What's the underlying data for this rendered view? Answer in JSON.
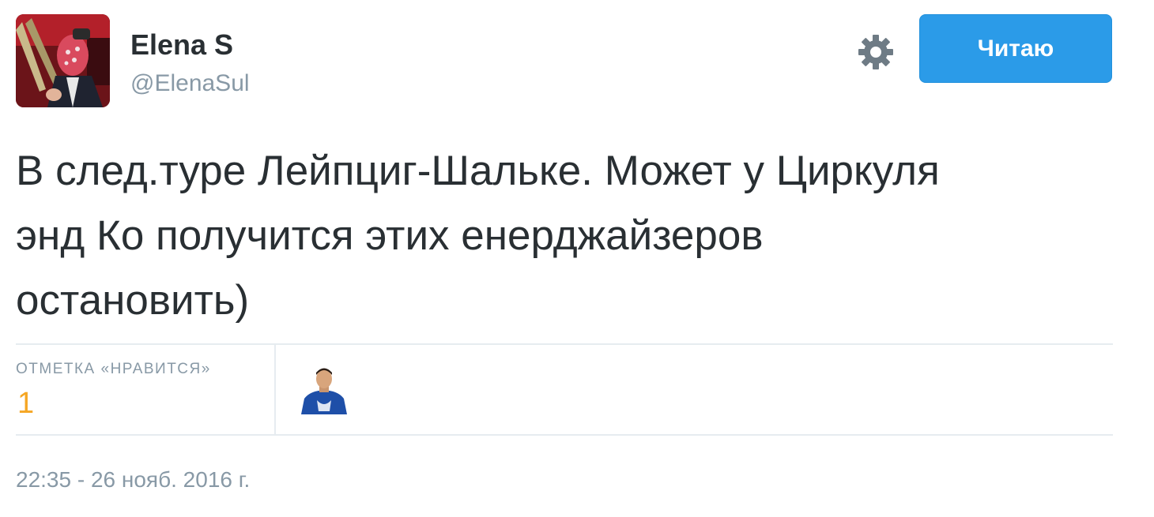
{
  "user": {
    "name": "Elena S",
    "handle": "@ElenaSul"
  },
  "actions": {
    "follow_label": "Читаю",
    "settings_icon": "gear-icon"
  },
  "tweet": {
    "text": "В след.туре Лейпциг-Шальке. Может у Циркуля энд Ко получится этих енерджайзеров остановить)"
  },
  "stats": {
    "likes_label": "ОТМЕТКА «НРАВИТСЯ»",
    "likes_count": "1"
  },
  "timestamp": "22:35 - 26 нояб. 2016 г.",
  "colors": {
    "accent": "#2b9be8",
    "likes_count": "#f5a623",
    "muted_text": "#8899a6"
  }
}
